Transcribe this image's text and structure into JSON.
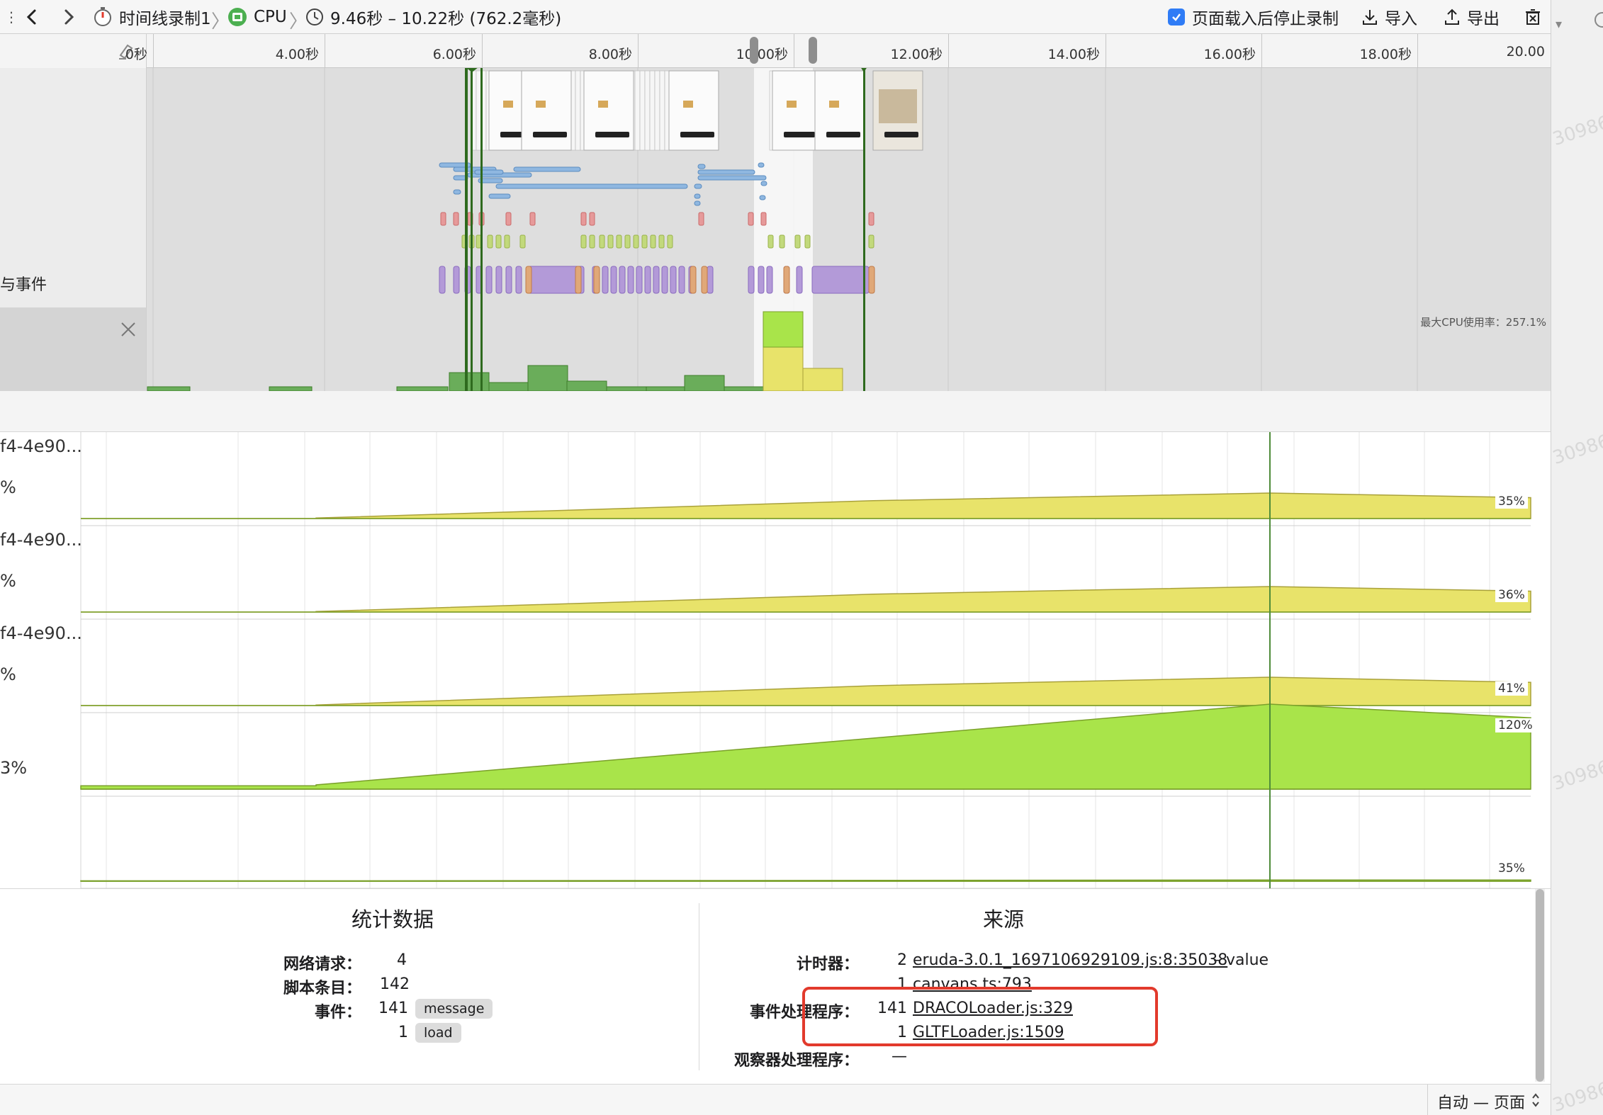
{
  "toolbar": {
    "recording_name": "时间线录制1",
    "cpu_label": "CPU",
    "range_label": "9.46秒 – 10.22秒 (762.2毫秒)",
    "stop_after_load_label": "页面载入后停止录制",
    "stop_after_load_checked": true,
    "import_label": "导入",
    "export_label": "导出"
  },
  "ruler": {
    "ticks": [
      {
        "label": "0秒"
      },
      {
        "label": "4.00秒"
      },
      {
        "label": "6.00秒"
      },
      {
        "label": "8.00秒"
      },
      {
        "label": "10.00秒"
      },
      {
        "label": "12.00秒"
      },
      {
        "label": "14.00秒"
      },
      {
        "label": "16.00秒"
      },
      {
        "label": "18.00秒"
      },
      {
        "label": "20.00"
      }
    ]
  },
  "tracks": {
    "events_label": "与事件",
    "max_cpu_label": "最大CPU使用率：257.1%"
  },
  "cpu_lanes": [
    {
      "label": "f4-4e90...",
      "pct_label": "%",
      "value_label": "35%"
    },
    {
      "label": "f4-4e90...",
      "pct_label": "%",
      "value_label": "36%"
    },
    {
      "label": "f4-4e90...",
      "pct_label": "%",
      "value_label": "41%"
    },
    {
      "label": "",
      "pct_label": "3%",
      "value_label": "120%"
    },
    {
      "label": "",
      "pct_label": "",
      "value_label": "35%"
    }
  ],
  "stats": {
    "title": "统计数据",
    "network_label": "网络请求：",
    "network_value": "4",
    "script_label": "脚本条目：",
    "script_value": "142",
    "events_label": "事件：",
    "events": [
      {
        "count": "141",
        "name": "message"
      },
      {
        "count": "1",
        "name": "load"
      }
    ]
  },
  "sources": {
    "title": "来源",
    "timers_label": "计时器：",
    "timers": [
      {
        "count": "2",
        "link": "eruda-3.0.1_1697106929109.js:8:35038",
        "suffix": "– value"
      },
      {
        "count": "1",
        "link": "canvans.ts:793",
        "suffix": ""
      }
    ],
    "handlers_label": "事件处理程序：",
    "handlers": [
      {
        "count": "141",
        "link": "DRACOLoader.js:329"
      },
      {
        "count": "1",
        "link": "GLTFLoader.js:1509"
      }
    ],
    "observers_label": "观察器处理程序：",
    "observers_value": "—"
  },
  "status": {
    "zoom_label": "自动 — 页面"
  },
  "watermark": "30986",
  "colors": {
    "accent": "#2f7cf6",
    "cpu_green": "#a9e44a",
    "cpu_yellow": "#e8e36a",
    "highlight_red": "#e23a2c",
    "marker_green": "#3d7d2a"
  }
}
